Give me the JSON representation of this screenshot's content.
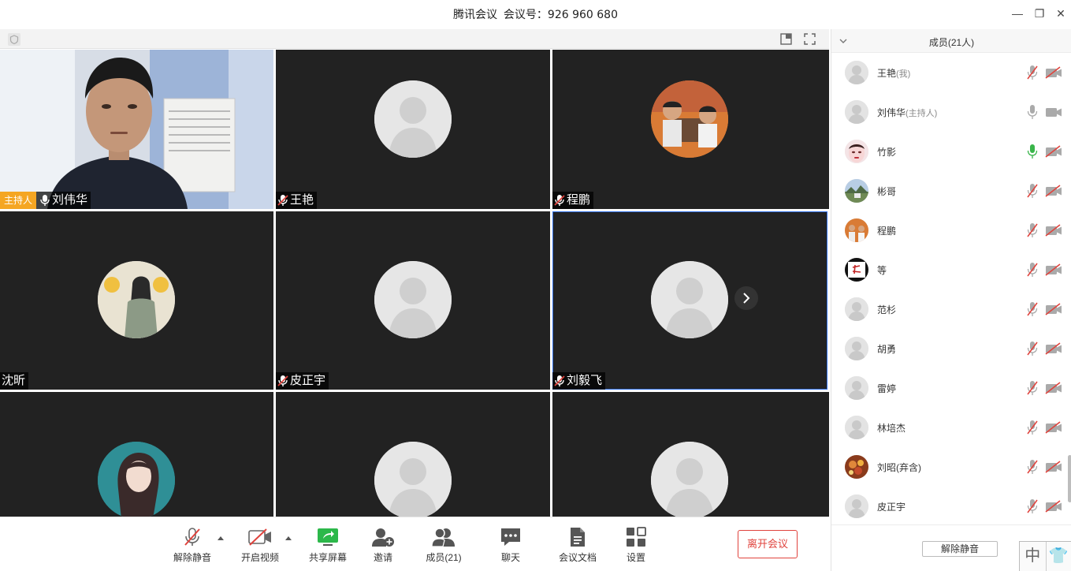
{
  "window": {
    "app_name": "腾讯会议",
    "meeting_label": "会议号：",
    "meeting_id": "926 960 680",
    "minimize": "—",
    "restore": "❐",
    "close": "✕"
  },
  "tiles": [
    {
      "name": "刘伟华",
      "badge": "主持人",
      "mic": "on",
      "type": "video"
    },
    {
      "name": "王艳",
      "mic": "muted",
      "type": "placeholder"
    },
    {
      "name": "程鹏",
      "mic": "muted",
      "type": "photo-kids"
    },
    {
      "name": "沈昕",
      "mic": "none",
      "type": "photo-girl"
    },
    {
      "name": "皮正宇",
      "mic": "muted",
      "type": "placeholder"
    },
    {
      "name": "刘毅飞",
      "mic": "muted",
      "type": "placeholder",
      "selected": true
    },
    {
      "name": "",
      "mic": "none",
      "type": "photo-anime"
    },
    {
      "name": "",
      "mic": "none",
      "type": "placeholder"
    },
    {
      "name": "",
      "mic": "none",
      "type": "placeholder"
    }
  ],
  "toolbar": {
    "unmute": "解除静音",
    "start_video": "开启视频",
    "share_screen": "共享屏幕",
    "invite": "邀请",
    "members": "成员(21)",
    "chat": "聊天",
    "docs": "会议文档",
    "settings": "设置",
    "leave": "离开会议"
  },
  "side_panel": {
    "title": "成员(21人)",
    "unmute_all": "解除静音",
    "ime_lang": "中",
    "ime_skin": "👕"
  },
  "members": [
    {
      "name": "王艳",
      "role": "(我)",
      "mic": "muted",
      "cam": "off",
      "avatar": "default"
    },
    {
      "name": "刘伟华",
      "role": "(主持人)",
      "mic": "on",
      "cam": "on",
      "avatar": "default"
    },
    {
      "name": "竹影",
      "role": "",
      "mic": "active",
      "cam": "off",
      "avatar": "face"
    },
    {
      "name": "彬哥",
      "role": "",
      "mic": "muted",
      "cam": "off",
      "avatar": "landscape"
    },
    {
      "name": "程鹏",
      "role": "",
      "mic": "muted",
      "cam": "off",
      "avatar": "kids"
    },
    {
      "name": "等",
      "role": "",
      "mic": "muted",
      "cam": "off",
      "avatar": "calligraphy"
    },
    {
      "name": "范杉",
      "role": "",
      "mic": "muted",
      "cam": "off",
      "avatar": "default"
    },
    {
      "name": "胡勇",
      "role": "",
      "mic": "muted",
      "cam": "off",
      "avatar": "default"
    },
    {
      "name": "雷婷",
      "role": "",
      "mic": "muted",
      "cam": "off",
      "avatar": "default"
    },
    {
      "name": "林培杰",
      "role": "",
      "mic": "muted",
      "cam": "off",
      "avatar": "default"
    },
    {
      "name": "刘昭(弃含)",
      "role": "",
      "mic": "muted",
      "cam": "off",
      "avatar": "food"
    },
    {
      "name": "皮正宇",
      "role": "",
      "mic": "muted",
      "cam": "off",
      "avatar": "default"
    }
  ],
  "colors": {
    "tile_bg": "#222222",
    "host_badge": "#f5a623",
    "leave_red": "#e0433d",
    "active_mic_green": "#39b54a",
    "muted_red": "#e0433d",
    "selected_outline": "#2f6fe6"
  }
}
